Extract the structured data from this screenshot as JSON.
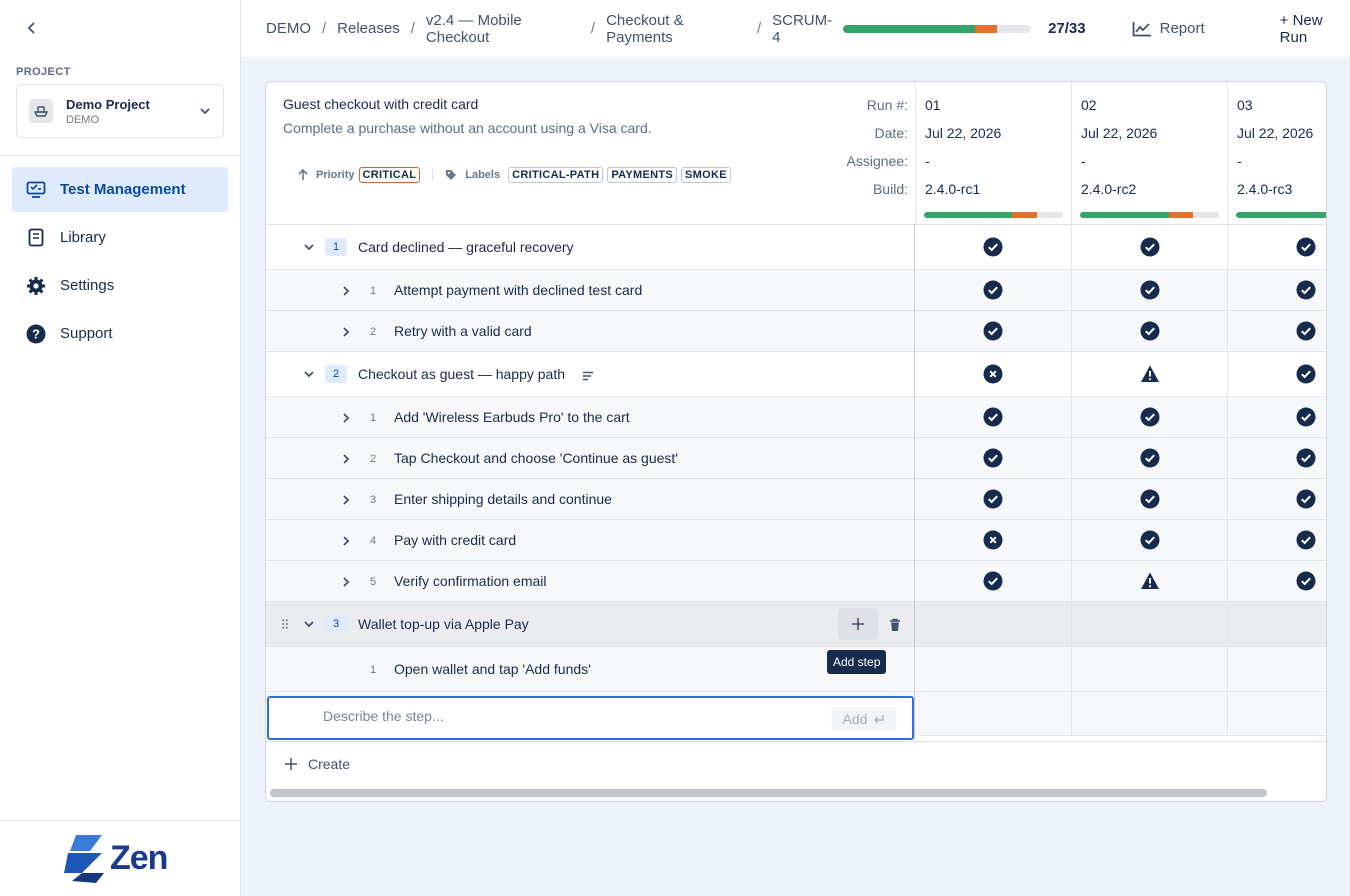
{
  "sidebar": {
    "project_label": "PROJECT",
    "project_name": "Demo Project",
    "project_key": "DEMO",
    "nav": [
      {
        "label": "Test Management",
        "icon": "monitor-icon",
        "active": true
      },
      {
        "label": "Library",
        "icon": "book-icon",
        "active": false
      },
      {
        "label": "Settings",
        "icon": "gear-icon",
        "active": false
      },
      {
        "label": "Support",
        "icon": "help-icon",
        "active": false
      }
    ],
    "logo_text": "Zen"
  },
  "topbar": {
    "breadcrumbs": [
      "DEMO",
      "Releases",
      "v2.4 — Mobile Checkout",
      "Checkout & Payments",
      "SCRUM-4"
    ],
    "progress_count": "27/33",
    "progress": {
      "passed": 0.7,
      "failed": 0.12
    },
    "report_label": "Report",
    "new_run_label": "+ New Run"
  },
  "case": {
    "title": "Guest checkout with credit card",
    "description": "Complete a purchase without an account using a Visa card.",
    "priority_label": "Priority",
    "priority": "CRITICAL",
    "labels_label": "Labels",
    "labels": [
      "CRITICAL-PATH",
      "PAYMENTS",
      "SMOKE"
    ]
  },
  "run_header_labels": {
    "run": "Run #:",
    "date": "Date:",
    "assignee": "Assignee:",
    "build": "Build:"
  },
  "runs": [
    {
      "run": "01",
      "date": "Jul 22, 2026",
      "assignee": "-",
      "build": "2.4.0-rc1",
      "passed": 0.63,
      "failed": 0.18
    },
    {
      "run": "02",
      "date": "Jul 22, 2026",
      "assignee": "-",
      "build": "2.4.0-rc2",
      "passed": 0.64,
      "failed": 0.17
    },
    {
      "run": "03",
      "date": "Jul 22, 2026",
      "assignee": "-",
      "build": "2.4.0-rc3",
      "passed": 1.0,
      "failed": 0
    }
  ],
  "groups": [
    {
      "num": "1",
      "title": "Card declined — graceful recovery",
      "statuses": [
        "pass",
        "pass",
        "pass"
      ],
      "steps": [
        {
          "num": "1",
          "text": "Attempt payment with declined test card",
          "statuses": [
            "pass",
            "pass",
            "pass"
          ]
        },
        {
          "num": "2",
          "text": "Retry with a valid card",
          "statuses": [
            "pass",
            "pass",
            "pass"
          ]
        }
      ]
    },
    {
      "num": "2",
      "title": "Checkout as guest — happy path",
      "statuses": [
        "fail",
        "warn",
        "pass"
      ],
      "steps": [
        {
          "num": "1",
          "text": "Add 'Wireless Earbuds Pro' to the cart",
          "statuses": [
            "pass",
            "pass",
            "pass"
          ]
        },
        {
          "num": "2",
          "text": "Tap Checkout and choose 'Continue as guest'",
          "statuses": [
            "pass",
            "pass",
            "pass"
          ]
        },
        {
          "num": "3",
          "text": "Enter shipping details and continue",
          "statuses": [
            "pass",
            "pass",
            "pass"
          ]
        },
        {
          "num": "4",
          "text": "Pay with credit card",
          "statuses": [
            "fail",
            "pass",
            "pass"
          ]
        },
        {
          "num": "5",
          "text": "Verify confirmation email",
          "statuses": [
            "pass",
            "warn",
            "pass"
          ]
        }
      ]
    },
    {
      "num": "3",
      "title": "Wallet top-up via Apple Pay",
      "statuses": [
        "",
        "",
        ""
      ],
      "steps": [
        {
          "num": "1",
          "text": "Open wallet and tap 'Add funds'",
          "statuses": [
            "",
            "",
            ""
          ]
        }
      ]
    }
  ],
  "tooltip": "Add step",
  "step_input": {
    "placeholder": "Describe the step...",
    "value": ""
  },
  "add_button_label": "Add",
  "create_label": "Create",
  "colors": {
    "pass": "#36a36b",
    "fail": "#e5702d",
    "accent": "#2f6fd6",
    "dark": "#172b4d"
  }
}
